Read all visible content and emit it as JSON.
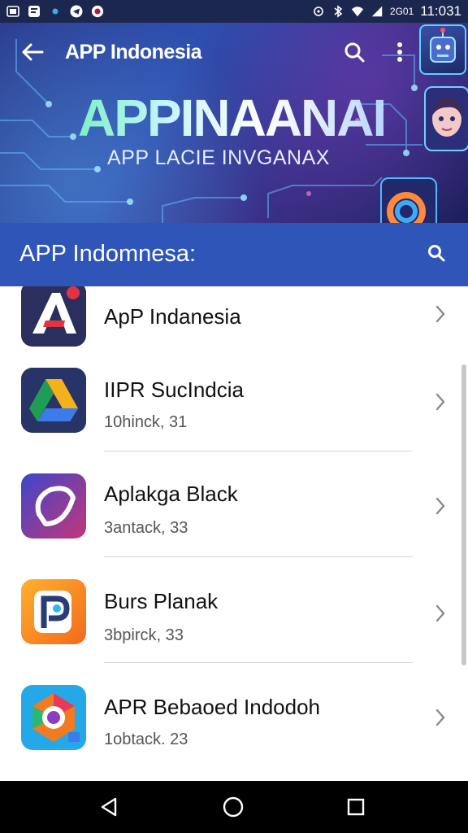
{
  "status_bar": {
    "left_icons": [
      "sim-icon",
      "notification-icon",
      "dot-icon",
      "telegram-icon",
      "record-icon"
    ],
    "network_label": "2G01",
    "time": "11:03",
    "time_suffix": "1"
  },
  "hero": {
    "title": "APP Indonesia",
    "big_title": "APPINAANAI",
    "subtitle": "APP LACIE INVGANAX",
    "colors": {
      "accent": "#59d2ff",
      "background": "#2e4fb0"
    }
  },
  "section": {
    "title": "APP Indomnesa:",
    "background": "#2f55b8"
  },
  "apps": [
    {
      "name": "ApP Indanesia",
      "sub": ""
    },
    {
      "name": "IIPR SucIndcia",
      "sub": "10hinck, 31"
    },
    {
      "name": "Aplakga Black",
      "sub": "3antack, 33"
    },
    {
      "name": "Burs Planak",
      "sub": "3bpirck, 33"
    },
    {
      "name": "APR Bebaoed Indodoh",
      "sub": "1obtack. 23"
    }
  ],
  "navigation": {
    "buttons": [
      "back-nav",
      "home-nav",
      "recents-nav"
    ]
  }
}
